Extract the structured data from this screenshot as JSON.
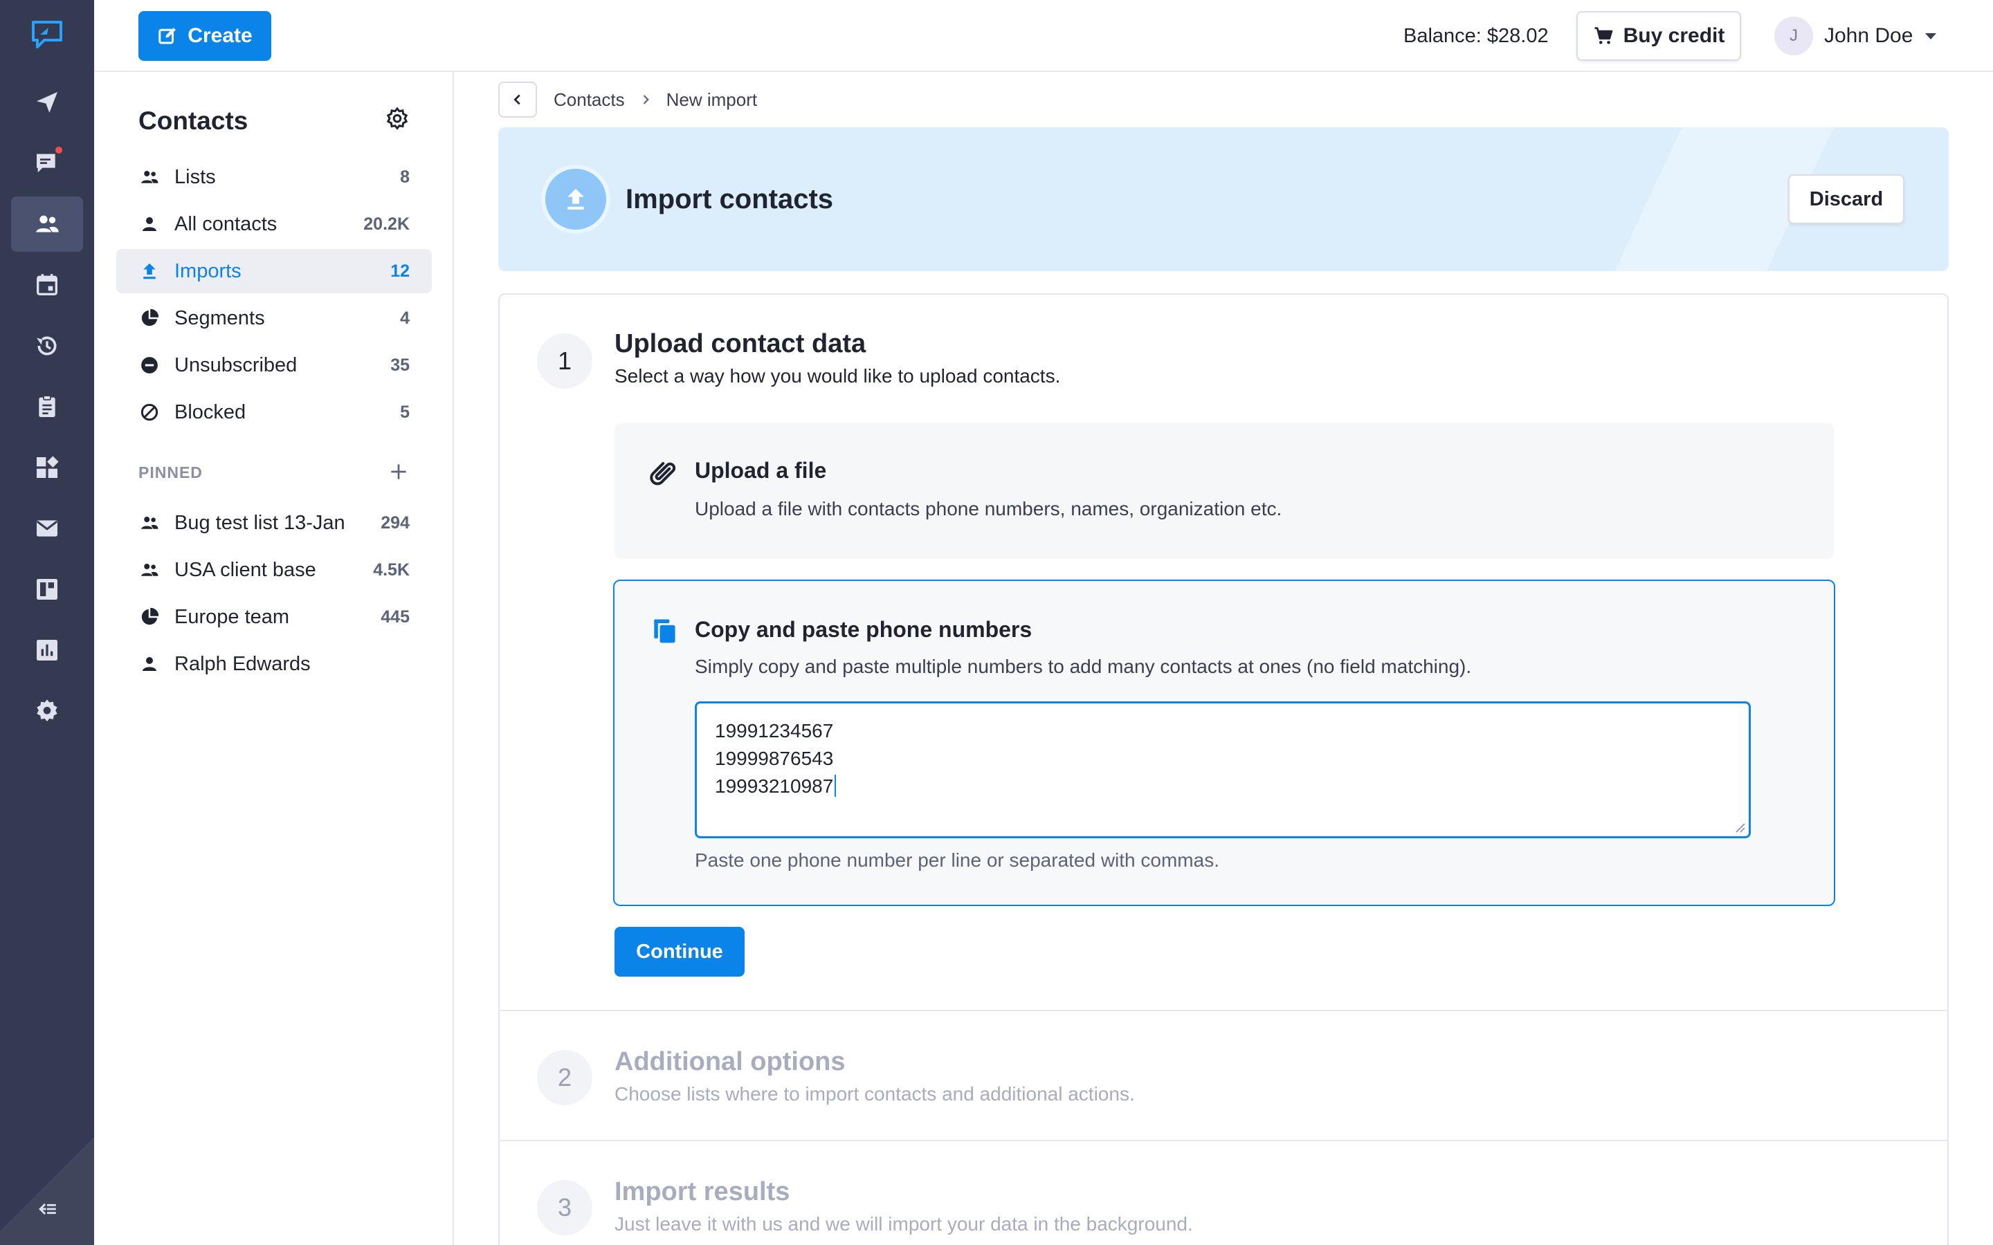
{
  "colors": {
    "accent": "#0a84e8",
    "rail_bg": "#333a52",
    "notification": "#ef4f4f",
    "hero_bg": "#dceefc"
  },
  "rail": {
    "items": [
      {
        "icon": "send-icon"
      },
      {
        "icon": "chat-icon",
        "badge": true
      },
      {
        "icon": "contacts-icon",
        "active": true
      },
      {
        "icon": "calendar-icon"
      },
      {
        "icon": "history-icon"
      },
      {
        "icon": "clipboard-icon"
      },
      {
        "icon": "apps-icon"
      },
      {
        "icon": "mail-icon"
      },
      {
        "icon": "dashboard-icon"
      },
      {
        "icon": "chart-icon"
      },
      {
        "icon": "settings-icon"
      }
    ],
    "collapse_icon": "collapse-icon"
  },
  "topbar": {
    "create_label": "Create",
    "balance": "Balance: $28.02",
    "buy_label": "Buy credit",
    "user_initial": "J",
    "user_name": "John Doe"
  },
  "sidebar": {
    "title": "Contacts",
    "items": [
      {
        "label": "Lists",
        "count": "8",
        "icon": "people-icon"
      },
      {
        "label": "All contacts",
        "count": "20.2K",
        "icon": "person-icon"
      },
      {
        "label": "Imports",
        "count": "12",
        "icon": "upload-icon",
        "active": true
      },
      {
        "label": "Segments",
        "count": "4",
        "icon": "pie-icon"
      },
      {
        "label": "Unsubscribed",
        "count": "35",
        "icon": "minus-circle-icon"
      },
      {
        "label": "Blocked",
        "count": "5",
        "icon": "block-icon"
      }
    ],
    "pinned_label": "PINNED",
    "pinned": [
      {
        "label": "Bug test list 13-Jan",
        "count": "294",
        "icon": "people-icon"
      },
      {
        "label": "USA client base",
        "count": "4.5K",
        "icon": "people-icon"
      },
      {
        "label": "Europe team",
        "count": "445",
        "icon": "pie-icon"
      },
      {
        "label": "Ralph Edwards",
        "count": "",
        "icon": "person-icon"
      }
    ]
  },
  "breadcrumb": {
    "parent": "Contacts",
    "current": "New import"
  },
  "hero": {
    "title": "Import contacts",
    "discard_label": "Discard"
  },
  "steps": [
    {
      "number": "1",
      "title": "Upload contact data",
      "subtitle": "Select a way how you would like to upload contacts."
    },
    {
      "number": "2",
      "title": "Additional options",
      "subtitle": "Choose lists where to import contacts and additional actions."
    },
    {
      "number": "3",
      "title": "Import results",
      "subtitle": "Just leave it with us and we will import your data in the background."
    }
  ],
  "options": {
    "file": {
      "title": "Upload a file",
      "desc": "Upload a file with contacts phone numbers, names, organization etc."
    },
    "paste": {
      "title": "Copy and paste phone numbers",
      "desc": "Simply copy and paste multiple numbers to add many contacts at ones (no field matching).",
      "value": "19991234567\n19999876543\n19993210987",
      "hint": "Paste one phone number per line or separated with commas."
    }
  },
  "continue_label": "Continue"
}
